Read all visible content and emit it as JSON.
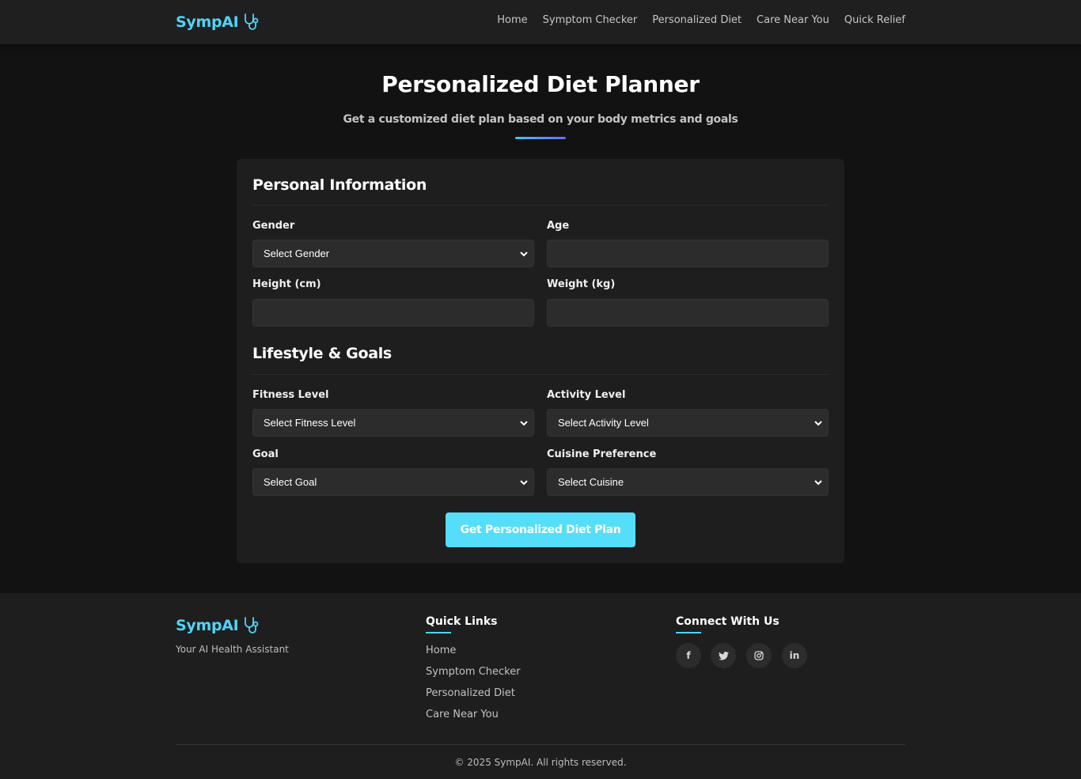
{
  "brand": {
    "name": "SympAI"
  },
  "nav": {
    "items": [
      {
        "label": "Home"
      },
      {
        "label": "Symptom Checker"
      },
      {
        "label": "Personalized Diet"
      },
      {
        "label": "Care Near You"
      },
      {
        "label": "Quick Relief"
      }
    ]
  },
  "hero": {
    "title": "Personalized Diet Planner",
    "subtitle": "Get a customized diet plan based on your body metrics and goals"
  },
  "form": {
    "personal": {
      "heading": "Personal Information",
      "gender_label": "Gender",
      "gender_value": "Select Gender",
      "age_label": "Age",
      "age_value": "",
      "height_label": "Height (cm)",
      "height_value": "",
      "weight_label": "Weight (kg)",
      "weight_value": ""
    },
    "lifestyle": {
      "heading": "Lifestyle & Goals",
      "fitness_label": "Fitness Level",
      "fitness_value": "Select Fitness Level",
      "activity_label": "Activity Level",
      "activity_value": "Select Activity Level",
      "goal_label": "Goal",
      "goal_value": "Select Goal",
      "cuisine_label": "Cuisine Preference",
      "cuisine_value": "Select Cuisine"
    },
    "submit_label": "Get Personalized Diet Plan"
  },
  "footer": {
    "brand": "SympAI",
    "tagline": "Your AI Health Assistant",
    "quick_links_heading": "Quick Links",
    "quick_links": [
      {
        "label": "Home"
      },
      {
        "label": "Symptom Checker"
      },
      {
        "label": "Personalized Diet"
      },
      {
        "label": "Care Near You"
      }
    ],
    "connect_heading": "Connect With Us",
    "social": [
      {
        "icon": "facebook-icon",
        "glyph": "f"
      },
      {
        "icon": "twitter-icon",
        "glyph": "t"
      },
      {
        "icon": "instagram-icon",
        "glyph": "◎"
      },
      {
        "icon": "linkedin-icon",
        "glyph": "in"
      }
    ],
    "copyright": "© 2025 SympAI. All rights reserved."
  },
  "colors": {
    "accent": "#4fd4f7",
    "button": "#55def9",
    "background": "#121212",
    "card": "#1e1e1e"
  }
}
